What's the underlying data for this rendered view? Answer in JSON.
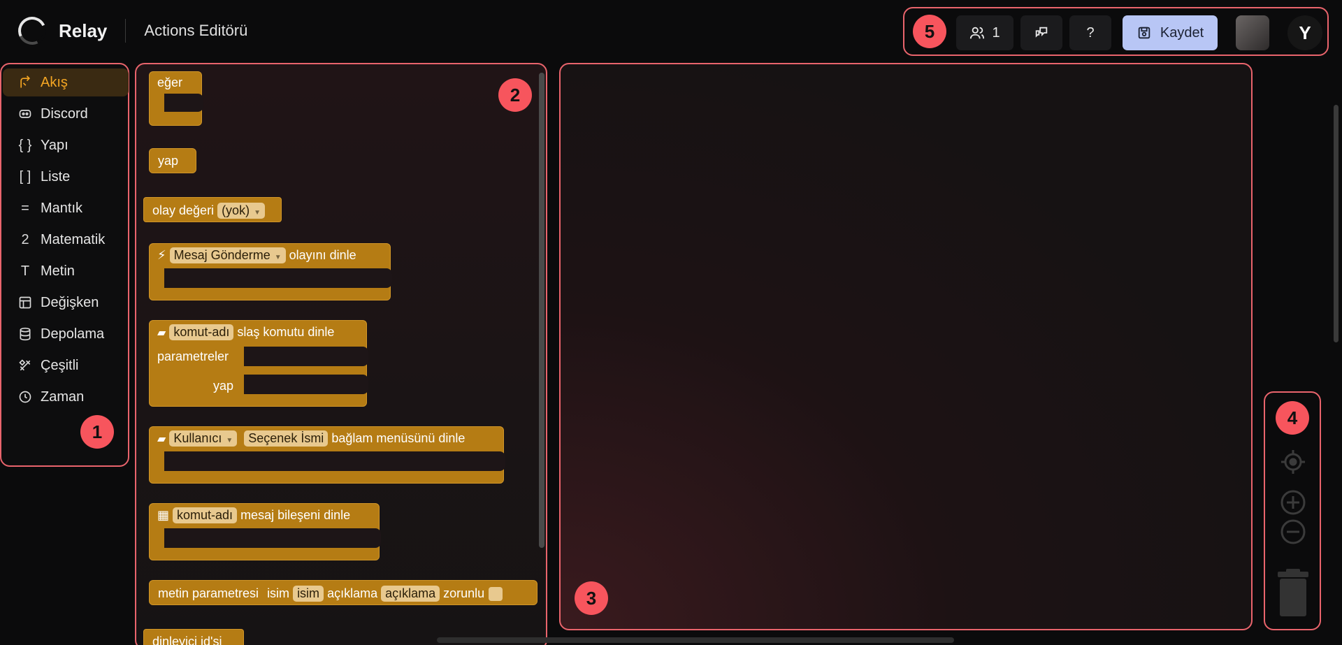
{
  "app": {
    "name": "Relay",
    "page_title": "Actions Editörü"
  },
  "toolbar": {
    "users_count": "1",
    "help_label": "?",
    "save_label": "Kaydet",
    "avatar_letter": "Y"
  },
  "markers": {
    "m1": "1",
    "m2": "2",
    "m3": "3",
    "m4": "4",
    "m5": "5"
  },
  "sidebar": {
    "items": [
      {
        "label": "Akış",
        "icon": "flow-icon",
        "active": true
      },
      {
        "label": "Discord",
        "icon": "discord-icon"
      },
      {
        "label": "Yapı",
        "icon": "braces-icon"
      },
      {
        "label": "Liste",
        "icon": "brackets-icon"
      },
      {
        "label": "Mantık",
        "icon": "equals-icon"
      },
      {
        "label": "Matematik",
        "icon": "number-icon"
      },
      {
        "label": "Metin",
        "icon": "text-icon"
      },
      {
        "label": "Değişken",
        "icon": "table-icon"
      },
      {
        "label": "Depolama",
        "icon": "database-icon"
      },
      {
        "label": "Çeşitli",
        "icon": "tools-icon"
      },
      {
        "label": "Zaman",
        "icon": "clock-icon"
      }
    ],
    "icon_glyphs": {
      "braces": "{ }",
      "brackets": "[ ]",
      "equals": "=",
      "number": "2",
      "text": "T"
    }
  },
  "palette": {
    "if_block": "eğer",
    "do_block": "yap",
    "event_value": {
      "label": "olay değeri",
      "option": "(yok)"
    },
    "message_event": {
      "option": "Mesaj Gönderme",
      "label": "olayını dinle"
    },
    "slash_command": {
      "name": "komut-adı",
      "label": "slaş komutu dinle",
      "params_label": "parametreler",
      "do_label": "yap"
    },
    "context_menu": {
      "option": "Kullanıcı",
      "name": "Seçenek İsmi",
      "label": "bağlam menüsünü dinle"
    },
    "component": {
      "name": "komut-adı",
      "label": "mesaj bileşeni dinle"
    },
    "text_param": {
      "label": "metin parametresi",
      "name_label": "isim",
      "name_value": "isim",
      "desc_label": "açıklama",
      "desc_value": "açıklama",
      "required_label": "zorunlu"
    },
    "listener_id": "dinleyici id'si"
  },
  "colors": {
    "accent": "#f5a623",
    "block": "#b57c14",
    "outline": "#e9646c",
    "save": "#b8c6f5",
    "marker": "#f7555d"
  }
}
